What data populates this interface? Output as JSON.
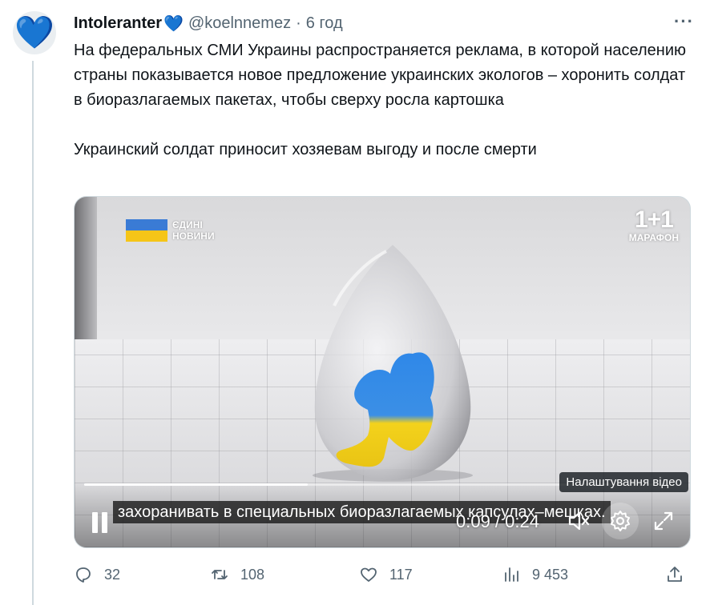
{
  "tweet": {
    "avatar_icon": "blue-heart-icon",
    "author_name": "Intoleranter",
    "author_badge": "💙",
    "handle": "@koelnnemez",
    "separator": "·",
    "time": "6 год",
    "more_icon": "more-horizontal-icon",
    "text": "На федеральных СМИ Украины распространяется реклама, в которой населению страны показывается новое предложение украинских экологов – хоронить солдат в биоразлагаемых пакетах, чтобы сверху росла картошка\n\nУкраинский солдат приносит хозяевам выгоду и после смерти"
  },
  "video": {
    "news_label_line1": "ЄДИНІ",
    "news_label_line2": "НОВИНИ",
    "channel_big": "1+1",
    "channel_small": "МАРАФОН",
    "subtitle": "захоранивать в специальных биоразлагаемых капсулах–мешках.",
    "tooltip": "Налаштування відео",
    "timecode": "0:09 / 0:24",
    "progress_fraction": 0.375,
    "colors": {
      "flag_blue": "#3a7bd5",
      "flag_yellow": "#f5c518"
    }
  },
  "actions": {
    "reply_count": "32",
    "retweet_count": "108",
    "like_count": "117",
    "views_count": "9 453",
    "icons": [
      "reply-icon",
      "retweet-icon",
      "like-icon",
      "views-icon",
      "share-icon"
    ]
  }
}
